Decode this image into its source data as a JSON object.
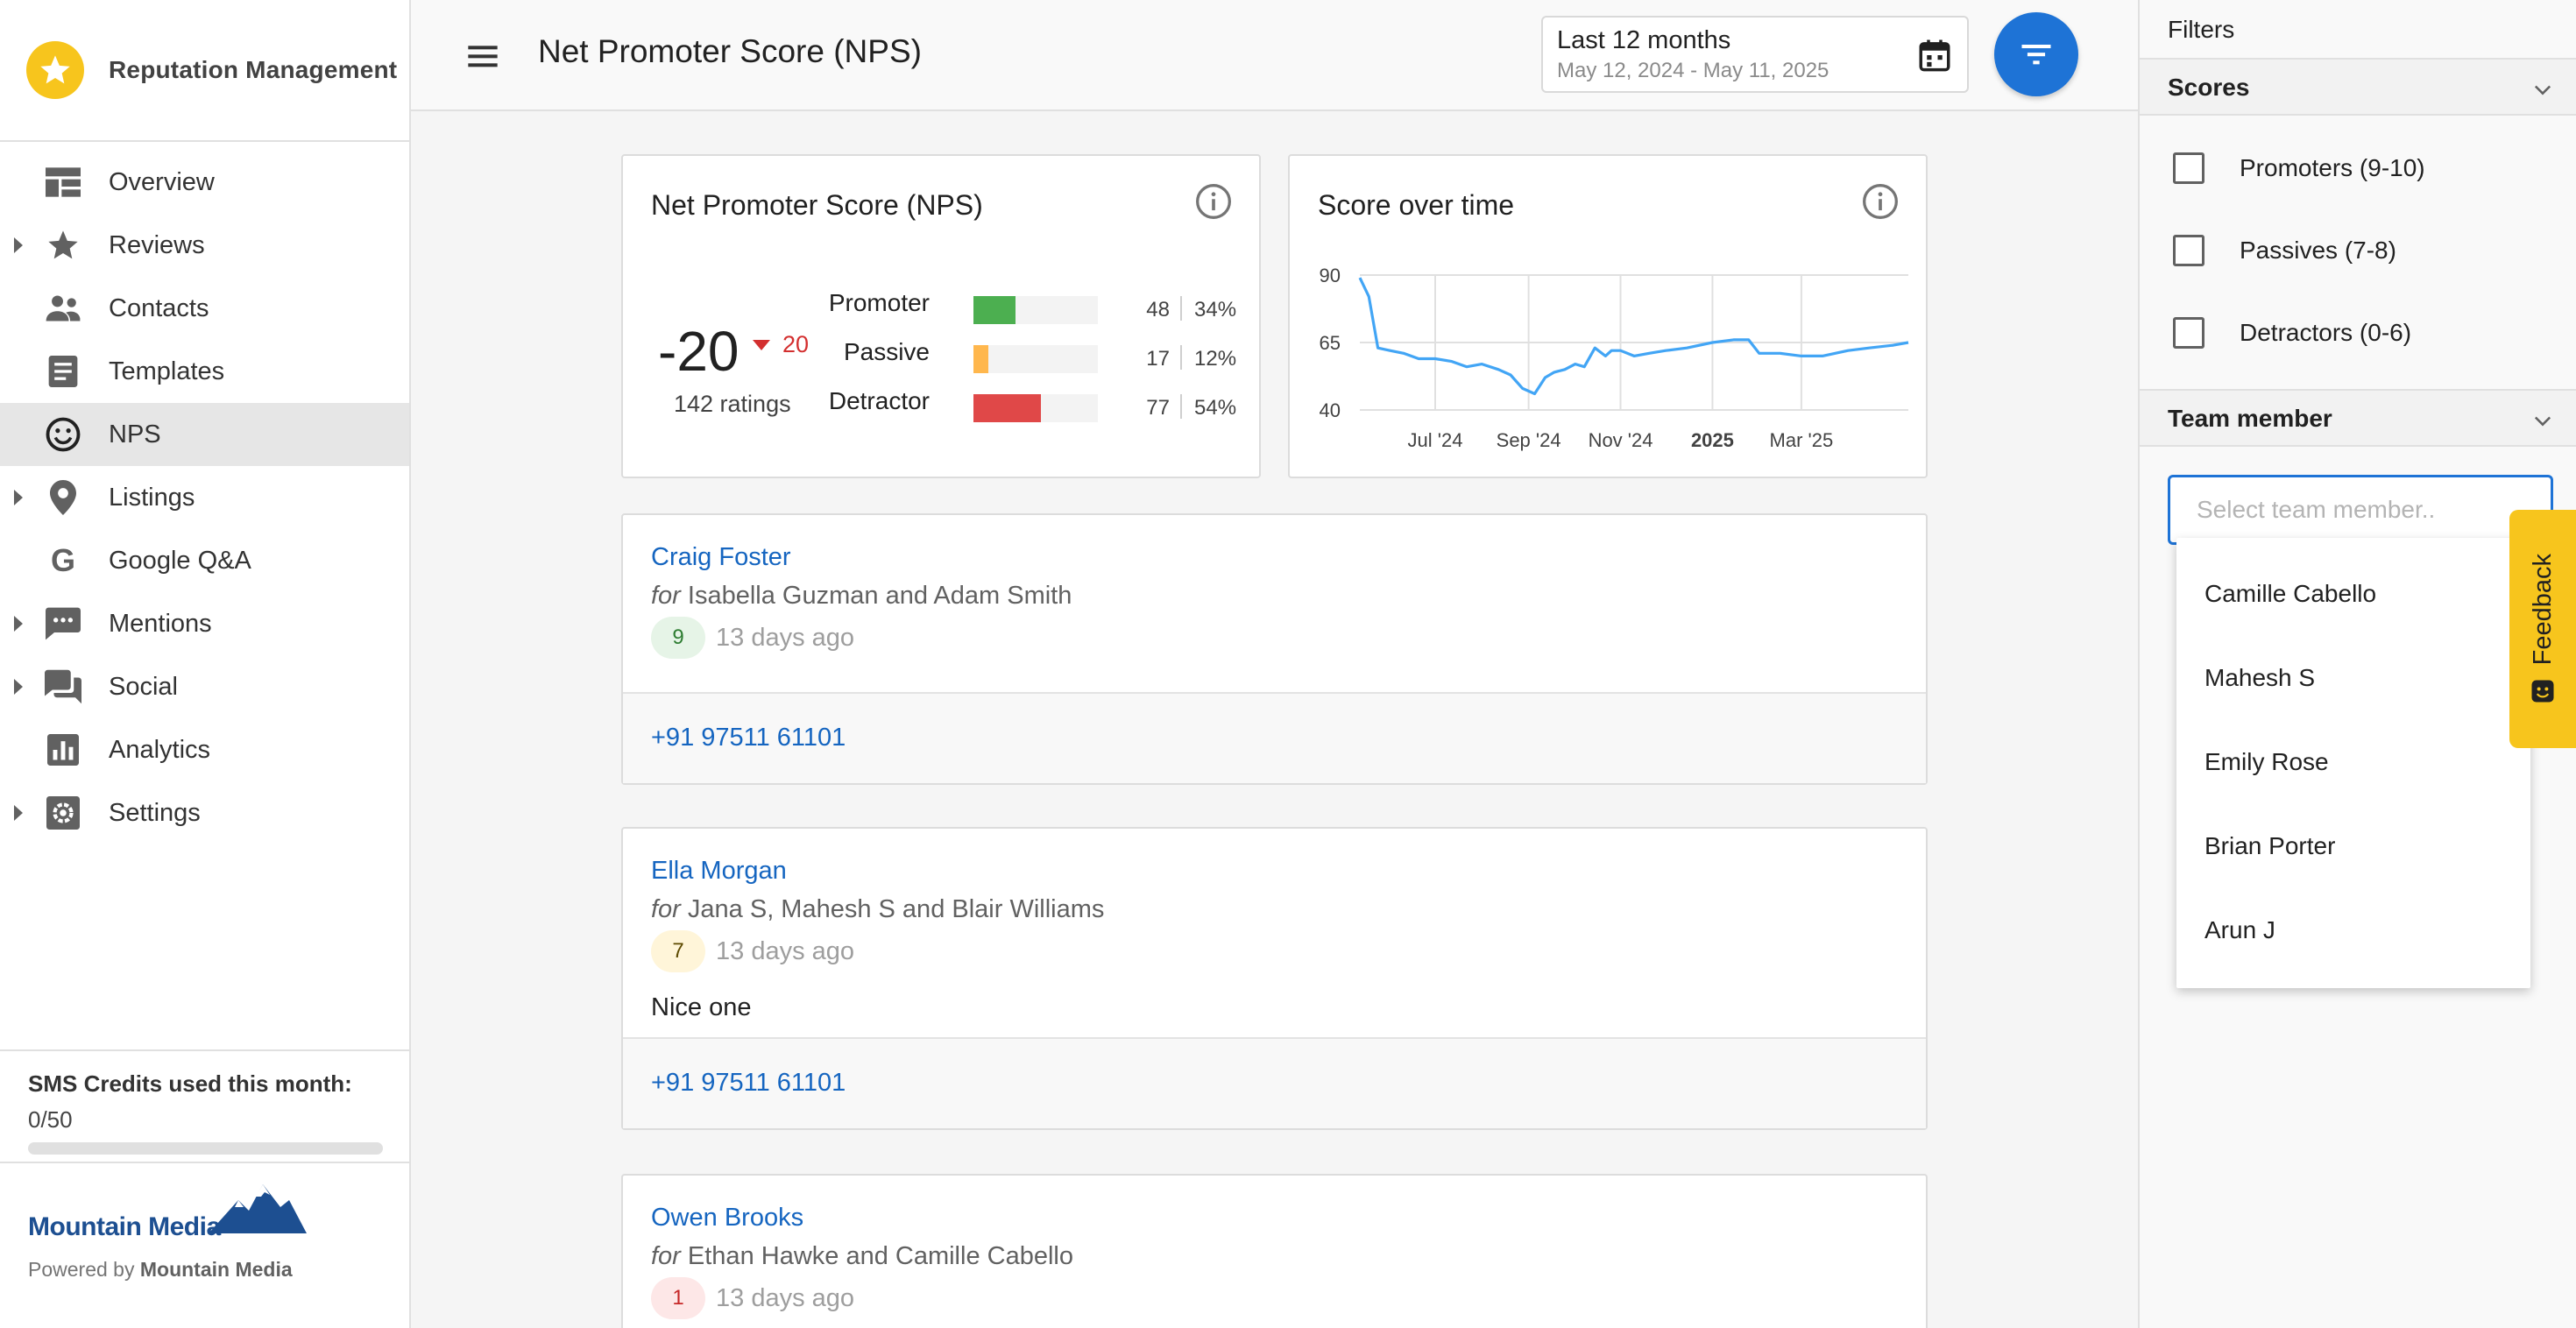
{
  "app": {
    "name": "Reputation Management"
  },
  "sidebar": {
    "items": [
      {
        "label": "Overview",
        "icon": "overview-icon",
        "expandable": false,
        "active": false
      },
      {
        "label": "Reviews",
        "icon": "star-icon",
        "expandable": true,
        "active": false
      },
      {
        "label": "Contacts",
        "icon": "contacts-icon",
        "expandable": false,
        "active": false
      },
      {
        "label": "Templates",
        "icon": "templates-icon",
        "expandable": false,
        "active": false
      },
      {
        "label": "NPS",
        "icon": "smiley-icon",
        "expandable": false,
        "active": true
      },
      {
        "label": "Listings",
        "icon": "location-pin-icon",
        "expandable": true,
        "active": false
      },
      {
        "label": "Google Q&A",
        "icon": "google-icon",
        "expandable": false,
        "active": false
      },
      {
        "label": "Mentions",
        "icon": "chat-bubble-icon",
        "expandable": true,
        "active": false
      },
      {
        "label": "Social",
        "icon": "forum-icon",
        "expandable": true,
        "active": false
      },
      {
        "label": "Analytics",
        "icon": "analytics-icon",
        "expandable": false,
        "active": false
      },
      {
        "label": "Settings",
        "icon": "settings-icon",
        "expandable": true,
        "active": false
      }
    ],
    "sms_title": "SMS Credits used this month:",
    "sms_value": "0/50",
    "sms_used_fraction": 0,
    "company_logo": "Mountain Media",
    "powered_by_prefix": "Powered by",
    "powered_by_company": "Mountain Media"
  },
  "header": {
    "title": "Net Promoter Score (NPS)",
    "date_label": "Last 12 months",
    "date_range": "May 12, 2024 - May 11, 2025"
  },
  "nps_card": {
    "title": "Net Promoter Score (NPS)",
    "score": "-20",
    "delta": "20",
    "ratings": "142 ratings",
    "breakdown": [
      {
        "name": "Promoter",
        "count": "48",
        "pct": "34%",
        "fraction": 0.34,
        "color": "#4caf50"
      },
      {
        "name": "Passive",
        "count": "17",
        "pct": "12%",
        "fraction": 0.12,
        "color": "#ffb74d"
      },
      {
        "name": "Detractor",
        "count": "77",
        "pct": "54%",
        "fraction": 0.54,
        "color": "#e04848"
      }
    ]
  },
  "score_card": {
    "title": "Score over time"
  },
  "chart_data": {
    "type": "line",
    "title": "Score over time",
    "x_tick_labels": [
      "Jul '24",
      "Sep '24",
      "Nov '24",
      "2025",
      "Mar '25"
    ],
    "x_tick_dates": [
      "2024-07-01",
      "2024-09-01",
      "2024-11-01",
      "2025-01-01",
      "2025-03-01"
    ],
    "y_ticks": [
      90,
      65,
      40
    ],
    "ylim": [
      40,
      90
    ],
    "xlim": [
      "2024-05-12",
      "2025-05-11"
    ],
    "grid": true,
    "color": "#42a5f5",
    "series": [
      {
        "x": [
          "2024-05-12",
          "2024-05-18",
          "2024-05-24",
          "2024-06-01",
          "2024-06-10",
          "2024-06-20",
          "2024-07-01",
          "2024-07-12",
          "2024-07-22",
          "2024-08-01",
          "2024-08-12",
          "2024-08-20",
          "2024-08-28",
          "2024-09-05",
          "2024-09-12",
          "2024-09-18",
          "2024-09-25",
          "2024-10-02",
          "2024-10-08",
          "2024-10-15",
          "2024-10-22",
          "2024-10-26",
          "2024-11-01",
          "2024-11-10",
          "2024-11-20",
          "2024-12-01",
          "2024-12-15",
          "2025-01-01",
          "2025-01-15",
          "2025-01-25",
          "2025-02-01",
          "2025-02-15",
          "2025-03-01",
          "2025-03-15",
          "2025-04-01",
          "2025-04-15",
          "2025-05-01",
          "2025-05-11"
        ],
        "y": [
          89,
          82,
          63,
          62,
          61,
          59,
          59,
          58,
          56,
          57,
          55,
          53,
          48,
          46,
          52,
          54,
          55,
          57,
          56,
          63,
          60,
          62,
          62,
          60,
          61,
          62,
          63,
          65,
          66,
          66,
          61,
          61,
          60,
          60,
          62,
          63,
          64,
          65
        ]
      }
    ]
  },
  "responses": [
    {
      "name": "Craig Foster",
      "for_prefix": "for",
      "for_names": "Isabella Guzman and Adam Smith",
      "score": "9",
      "time": "13 days ago",
      "comment": "",
      "phone": "+91 97511 61101"
    },
    {
      "name": "Ella Morgan",
      "for_prefix": "for",
      "for_names": "Jana S, Mahesh S and Blair Williams",
      "score": "7",
      "time": "13 days ago",
      "comment": "Nice one",
      "phone": "+91 97511 61101"
    },
    {
      "name": "Owen Brooks",
      "for_prefix": "for",
      "for_names": "Ethan Hawke and Camille Cabello",
      "score": "1",
      "time": "13 days ago",
      "comment": "",
      "phone": ""
    }
  ],
  "filters": {
    "title": "Filters",
    "scores_title": "Scores",
    "scores": [
      "Promoters (9-10)",
      "Passives (7-8)",
      "Detractors (0-6)"
    ],
    "team_title": "Team member",
    "team_placeholder": "Select team member..",
    "team_options": [
      "Camille Cabello",
      "Mahesh S",
      "Emily Rose",
      "Brian Porter",
      "Arun J"
    ]
  },
  "feedback": {
    "label": "Feedback"
  },
  "colors": {
    "accent": "#1e73d6",
    "brand_yellow": "#f7c51d",
    "link": "#1565c0",
    "negative": "#d32f2f"
  }
}
